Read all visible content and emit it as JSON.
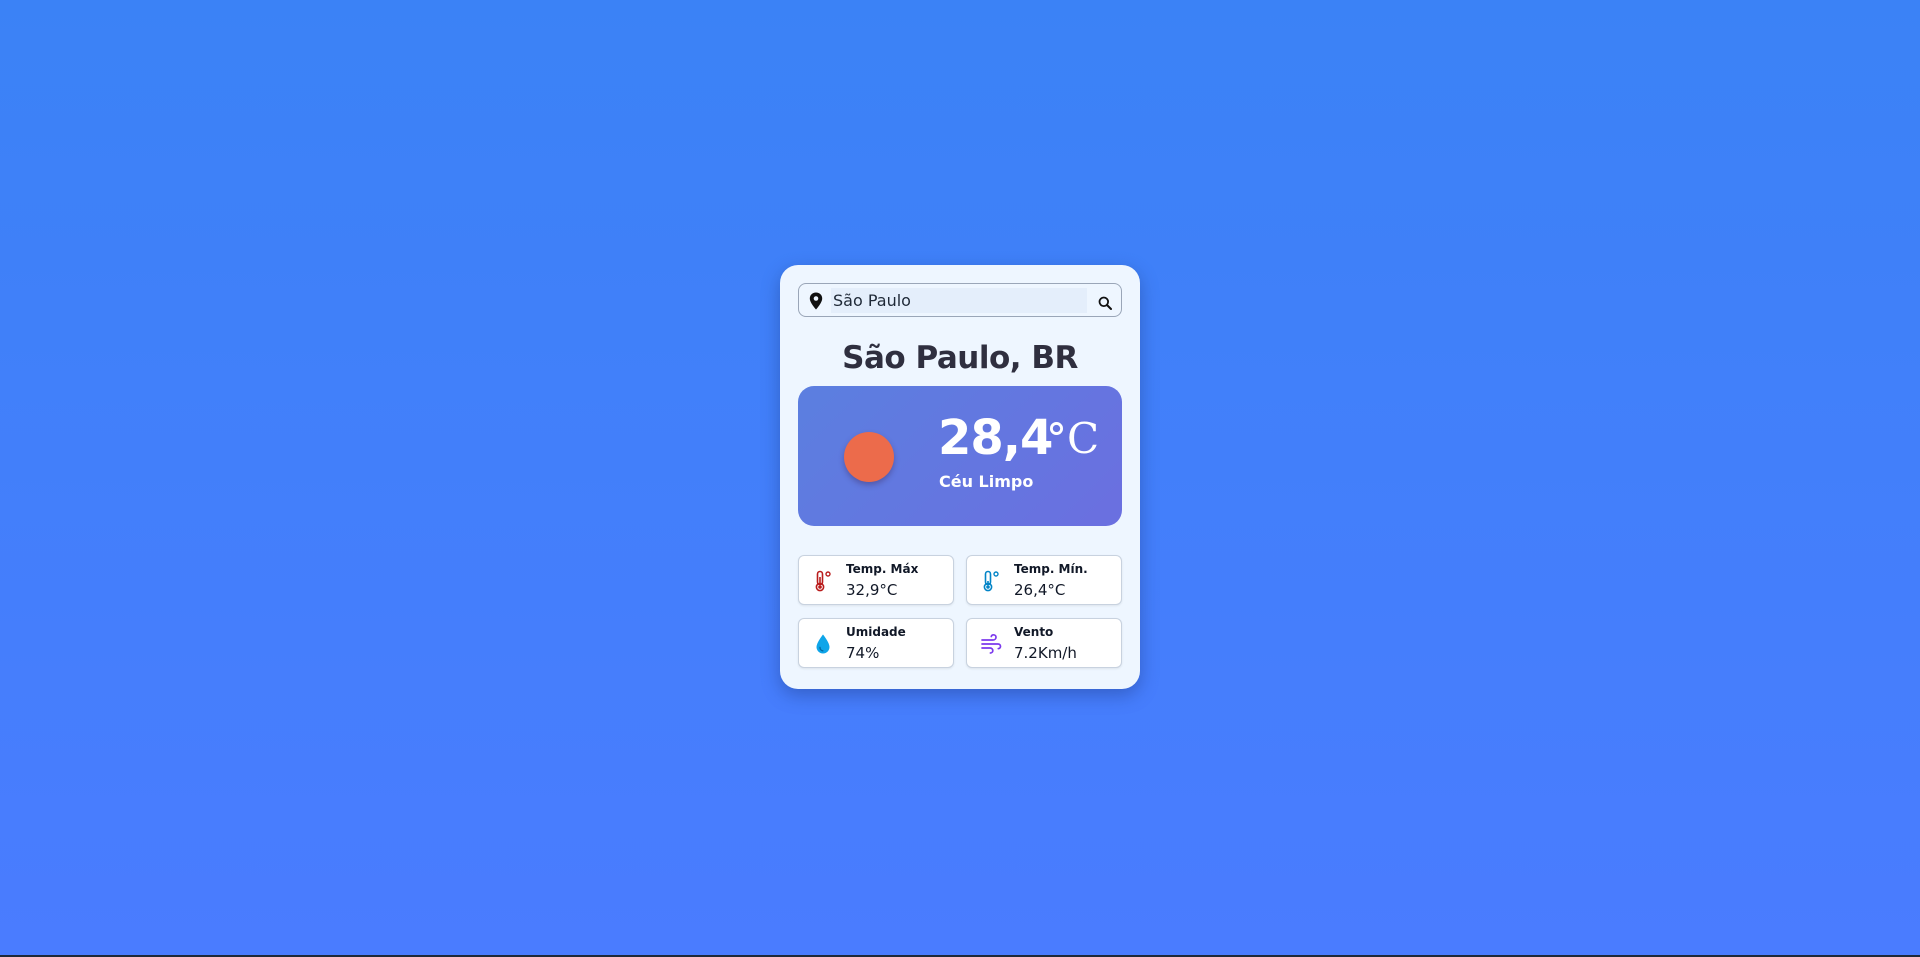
{
  "search": {
    "value": "São Paulo",
    "pin_icon": "location-pin-icon",
    "button_icon": "search-icon"
  },
  "location": {
    "title": "São Paulo, BR"
  },
  "current": {
    "temperature": "28,4",
    "unit": "°C",
    "condition": "Céu Limpo",
    "icon": "sun-icon",
    "icon_color": "#ec6b4b"
  },
  "stats": {
    "max": {
      "label": "Temp. Máx",
      "value": "32,9°C",
      "icon": "thermometer-hot-icon",
      "color": "#b91c1c"
    },
    "min": {
      "label": "Temp. Mín.",
      "value": "26,4°C",
      "icon": "thermometer-cold-icon",
      "color": "#0284c7"
    },
    "humidity": {
      "label": "Umidade",
      "value": "74%",
      "icon": "water-drop-icon",
      "color": "#0ea5e9"
    },
    "wind": {
      "label": "Vento",
      "value": "7.2Km/h",
      "icon": "wind-icon",
      "color": "#7c3aed"
    }
  },
  "colors": {
    "background": "#3b82f6",
    "card": "#eef6ff",
    "panel": "#5b7fe0"
  }
}
